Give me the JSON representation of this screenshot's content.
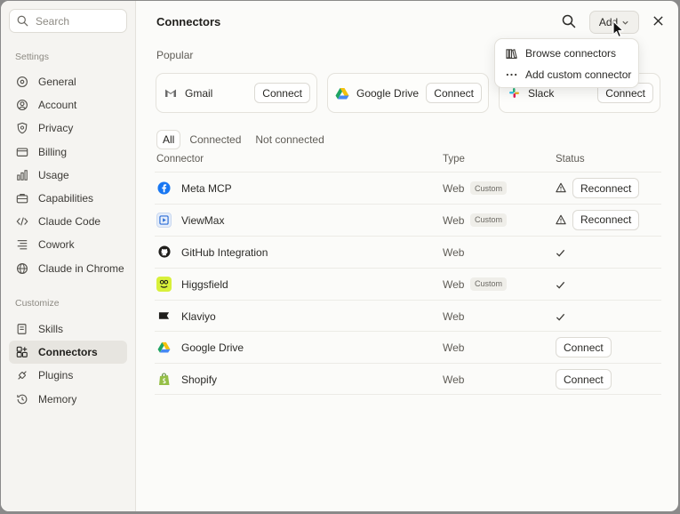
{
  "sidebar": {
    "search_placeholder": "Search",
    "settings_label": "Settings",
    "settings_items": [
      {
        "label": "General",
        "icon": "sliders-icon"
      },
      {
        "label": "Account",
        "icon": "user-circle-icon"
      },
      {
        "label": "Privacy",
        "icon": "shield-icon"
      },
      {
        "label": "Billing",
        "icon": "card-icon"
      },
      {
        "label": "Usage",
        "icon": "bar-chart-icon"
      },
      {
        "label": "Capabilities",
        "icon": "briefcase-icon"
      },
      {
        "label": "Claude Code",
        "icon": "code-icon"
      },
      {
        "label": "Cowork",
        "icon": "list-icon"
      },
      {
        "label": "Claude in Chrome",
        "icon": "globe-icon"
      }
    ],
    "customize_label": "Customize",
    "customize_items": [
      {
        "label": "Skills",
        "icon": "book-icon"
      },
      {
        "label": "Connectors",
        "icon": "connector-icon",
        "active": true
      },
      {
        "label": "Plugins",
        "icon": "plugin-icon"
      },
      {
        "label": "Memory",
        "icon": "memory-icon"
      }
    ]
  },
  "main": {
    "title": "Connectors",
    "add_label": "Add",
    "popular_label": "Popular",
    "popular": [
      {
        "name": "Gmail",
        "action": "Connect"
      },
      {
        "name": "Google Drive",
        "action": "Connect"
      },
      {
        "name": "Slack",
        "action": "Connect"
      }
    ],
    "tabs": [
      "All",
      "Connected",
      "Not connected"
    ],
    "columns": {
      "connector": "Connector",
      "type": "Type",
      "status": "Status"
    },
    "rows": [
      {
        "name": "Meta MCP",
        "type": "Web",
        "badge": "Custom",
        "status": "warning",
        "action": "Reconnect"
      },
      {
        "name": "ViewMax",
        "type": "Web",
        "badge": "Custom",
        "status": "warning",
        "action": "Reconnect"
      },
      {
        "name": "GitHub Integration",
        "type": "Web",
        "badge": "",
        "status": "connected",
        "action": ""
      },
      {
        "name": "Higgsfield",
        "type": "Web",
        "badge": "Custom",
        "status": "connected",
        "action": ""
      },
      {
        "name": "Klaviyo",
        "type": "Web",
        "badge": "",
        "status": "connected",
        "action": ""
      },
      {
        "name": "Google Drive",
        "type": "Web",
        "badge": "",
        "status": "disconnected",
        "action": "Connect"
      },
      {
        "name": "Shopify",
        "type": "Web",
        "badge": "",
        "status": "disconnected",
        "action": "Connect"
      }
    ]
  },
  "dropdown": {
    "items": [
      {
        "label": "Browse connectors",
        "icon": "library-icon"
      },
      {
        "label": "Add custom connector",
        "icon": "more-icon"
      }
    ]
  }
}
